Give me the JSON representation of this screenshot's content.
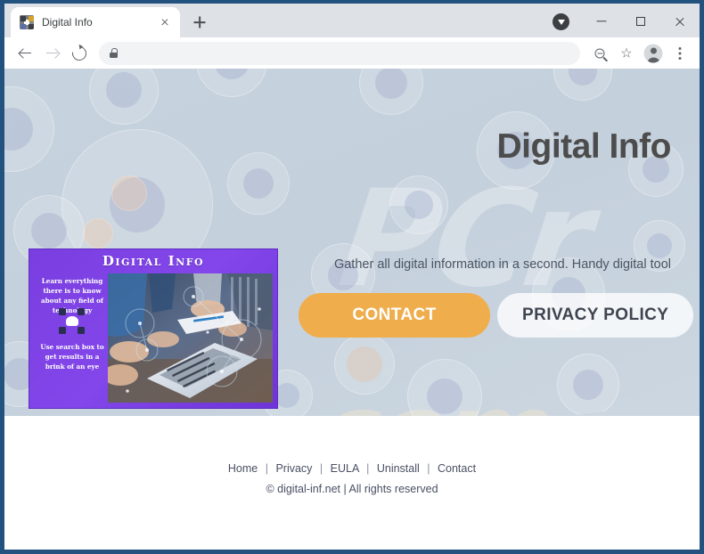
{
  "browser": {
    "tab": {
      "title": "Digital Info",
      "favicon_icon": "digital-info-favicon",
      "close_icon": "close-icon"
    },
    "new_tab_icon": "plus-icon",
    "profile_badge_icon": "profile-badge-icon",
    "window_controls": {
      "minimize_icon": "minimize-icon",
      "maximize_icon": "maximize-icon",
      "close_icon": "close-icon"
    },
    "toolbar": {
      "back_icon": "arrow-left-icon",
      "forward_icon": "arrow-right-icon",
      "reload_icon": "reload-icon",
      "lock_icon": "lock-icon",
      "url_value": "",
      "url_placeholder": "",
      "zoom_icon": "magnifier-icon",
      "bookmark_icon": "star-icon",
      "profile_icon": "account-avatar-icon",
      "menu_icon": "three-dot-menu-icon"
    }
  },
  "page": {
    "hero": {
      "title": "Digital Info",
      "tagline": "Gather all digital information in a second. Handy digital tool",
      "watermark_top": "PCr",
      "watermark_bottom": "com",
      "buttons": [
        {
          "label": "CONTACT",
          "name": "contact-button",
          "style": "primary"
        },
        {
          "label": "PRIVACY POLICY",
          "name": "privacy-policy-button",
          "style": "secondary"
        }
      ]
    },
    "promo": {
      "title": "Digital Info",
      "copy_1": "Learn everything there is to know about any field of technology",
      "copy_2": "Use search box to get results in a brink of an eye",
      "icon": "network-cloud-icon",
      "photo_alt": "team-working-on-laptop-photo"
    },
    "footer": {
      "links": [
        {
          "label": "Home",
          "name": "footer-link-home"
        },
        {
          "label": "Privacy",
          "name": "footer-link-privacy"
        },
        {
          "label": "EULA",
          "name": "footer-link-eula"
        },
        {
          "label": "Uninstall",
          "name": "footer-link-uninstall"
        },
        {
          "label": "Contact",
          "name": "footer-link-contact"
        }
      ],
      "separator": "|",
      "copyright": "© digital-inf.net | All rights reserved"
    }
  },
  "colors": {
    "window_frame": "#24527f",
    "hero_background": "#c6d2dd",
    "accent_orange": "#efad4b",
    "promo_purple": "#7a3ee0",
    "heading_gray": "#4c4c4c",
    "footer_text": "#4a4f63"
  }
}
